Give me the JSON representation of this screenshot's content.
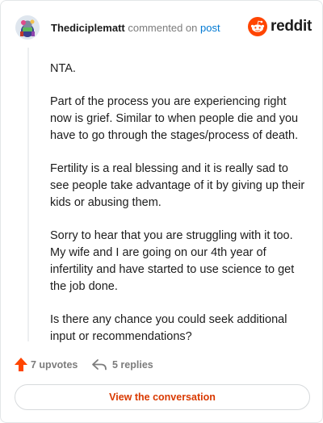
{
  "header": {
    "username": "Thediciplematt",
    "action_text": "commented on",
    "target_link": "post",
    "brand": "reddit"
  },
  "comment": {
    "paragraphs": [
      "NTA.",
      "Part of the process you are experiencing right now is grief. Similar to when people die and you have to go through the stages/process of death.",
      "Fertility is a real blessing and it is really sad to see people take advantage of it by giving up their kids or abusing them.",
      "Sorry to hear that you are struggling with it too. My wife and I are going on our 4th year of infertility and have started to use science to get the job done.",
      "Is there any chance you could seek additional input or recommendations?"
    ]
  },
  "footer": {
    "upvotes_label": "7 upvotes",
    "replies_label": "5 replies",
    "view_button": "View the conversation"
  },
  "icons": {
    "upvote": "upvote-arrow-icon",
    "reply": "reply-arrow-icon",
    "brand": "reddit-snoo-icon",
    "avatar": "user-avatar"
  },
  "colors": {
    "accent": "#ff4500",
    "link": "#0079d3",
    "button_text": "#d93900",
    "muted": "#7c7c7c"
  }
}
